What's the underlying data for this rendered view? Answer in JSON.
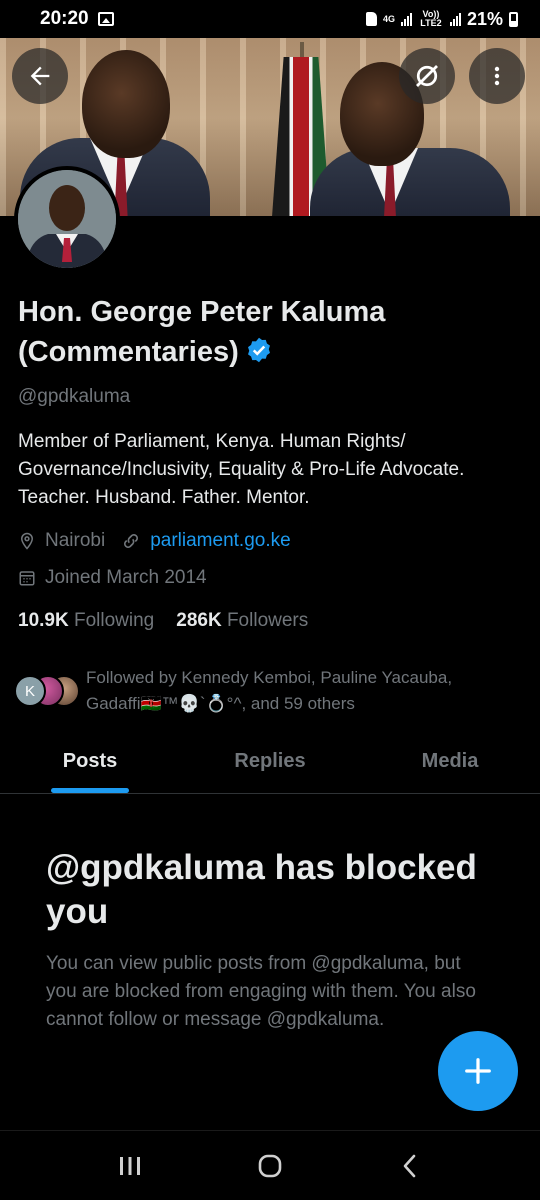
{
  "status_bar": {
    "time": "20:20",
    "network": "4G",
    "volte": "Vo)) LTE2",
    "battery": "21%"
  },
  "header": {
    "back_icon": "arrow-left-icon",
    "grok_icon": "grok-icon",
    "more_icon": "more-vertical-icon"
  },
  "profile": {
    "name": "Hon. George Peter Kaluma (Commentaries)",
    "handle": "@gpdkaluma",
    "bio": "Member of Parliament, Kenya. Human Rights/ Governance/Inclusivity, Equality & Pro-Life Advocate. Teacher. Husband. Father. Mentor.",
    "location": "Nairobi",
    "website": "parliament.go.ke",
    "joined": "Joined March 2014",
    "following_count": "10.9K",
    "following_label": "Following",
    "followers_count": "286K",
    "followers_label": "Followers",
    "followed_by": "Followed by Kennedy Kemboi, Pauline Yacauba, Gadaffi🇰🇪™💀`💍°^, and 59 others",
    "mini_avatar_letter": "K"
  },
  "tabs": [
    {
      "label": "Posts",
      "active": true
    },
    {
      "label": "Replies",
      "active": false
    },
    {
      "label": "Media",
      "active": false
    }
  ],
  "blocked": {
    "title": "@gpdkaluma has blocked you",
    "description": "You can view public posts from @gpdkaluma, but you are blocked from engaging with them. You also cannot follow or message @gpdkaluma."
  },
  "colors": {
    "accent": "#1d9bf0",
    "background": "#000000",
    "text_primary": "#e7e9ea",
    "text_secondary": "#71767b"
  }
}
